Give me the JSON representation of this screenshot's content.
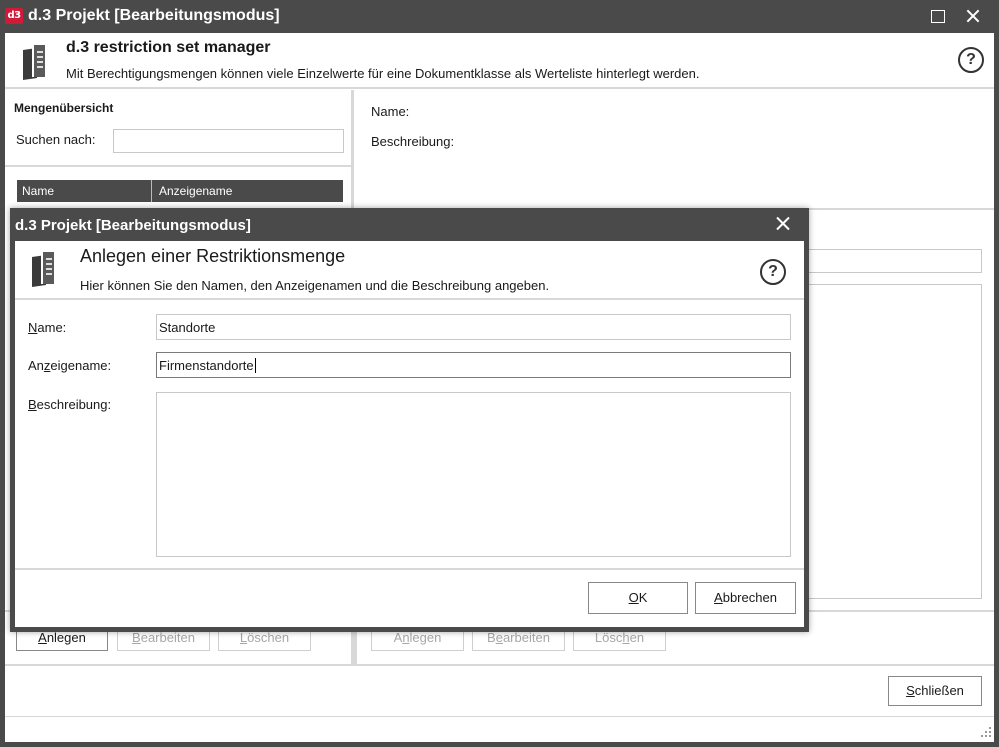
{
  "window": {
    "logo_text": "d3",
    "title": "d.3 Projekt [Bearbeitungsmodus]"
  },
  "header": {
    "title": "d.3 restriction set manager",
    "subtitle": "Mit Berechtigungsmengen können viele Einzelwerte für eine Dokumentklasse als Werteliste hinterlegt werden.",
    "help_glyph": "?"
  },
  "left_pane": {
    "heading": "Mengenübersicht",
    "search_label": "Suchen nach:",
    "search_value": "",
    "columns": [
      "Name",
      "Anzeigename"
    ],
    "buttons": {
      "create": {
        "pre": "",
        "key": "A",
        "post": "nlegen"
      },
      "edit": {
        "pre": "",
        "key": "B",
        "post": "earbeiten"
      },
      "delete": {
        "pre": "",
        "key": "L",
        "post": "öschen"
      }
    }
  },
  "right_pane": {
    "name_label": "Name:",
    "description_label": "Beschreibung:",
    "buttons": {
      "create": {
        "pre": "A",
        "key": "n",
        "post": "legen"
      },
      "edit": {
        "pre": "B",
        "key": "e",
        "post": "arbeiten"
      },
      "delete": {
        "pre": "Lösc",
        "key": "h",
        "post": "en"
      }
    }
  },
  "footer": {
    "close": {
      "pre": "",
      "key": "S",
      "post": "chließen"
    }
  },
  "dialog": {
    "title": "d.3 Projekt [Bearbeitungsmodus]",
    "header_title": "Anlegen einer Restriktionsmenge",
    "header_subtitle": "Hier können Sie den Namen, den Anzeigenamen und die Beschreibung angeben.",
    "help_glyph": "?",
    "fields": {
      "name": {
        "label_pre": "",
        "label_key": "N",
        "label_post": "ame:",
        "value": "Standorte"
      },
      "display_name": {
        "label_pre": "An",
        "label_key": "z",
        "label_post": "eigename:",
        "value": "Firmenstandorte"
      },
      "description": {
        "label_pre": "",
        "label_key": "B",
        "label_post": "eschreibung:",
        "value": ""
      }
    },
    "ok": {
      "pre": "",
      "key": "O",
      "post": "K"
    },
    "cancel": {
      "pre": "",
      "key": "A",
      "post": "bbrechen"
    }
  }
}
